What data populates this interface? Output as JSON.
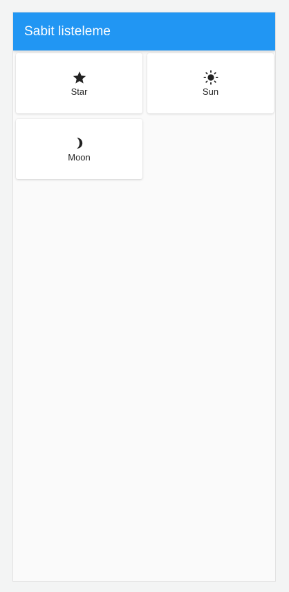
{
  "appbar": {
    "title": "Sabit listeleme",
    "color": "#2196f3"
  },
  "items": [
    {
      "label": "Star",
      "icon": "star-icon"
    },
    {
      "label": "Sun",
      "icon": "sun-icon"
    },
    {
      "label": "Moon",
      "icon": "moon-icon"
    }
  ]
}
